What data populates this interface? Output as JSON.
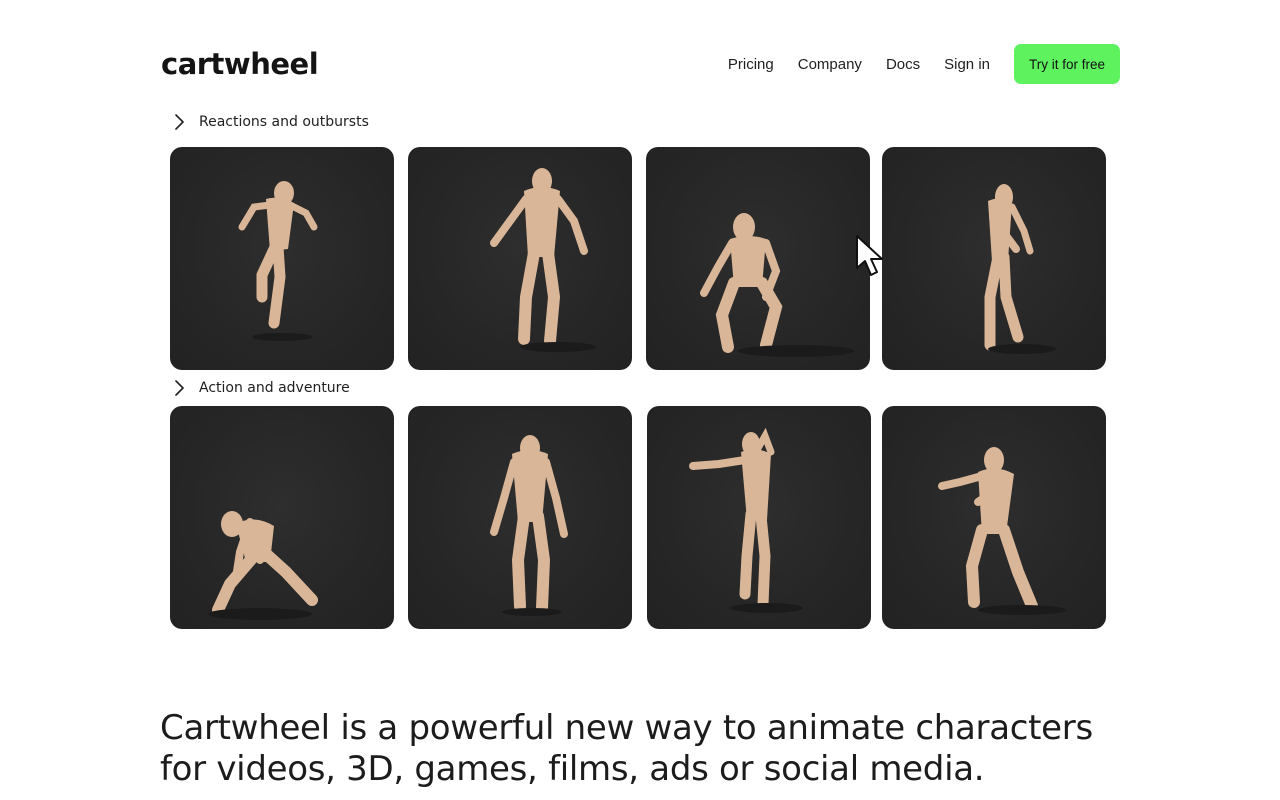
{
  "nav": {
    "logo": "cartwheel",
    "links": [
      "Pricing",
      "Company",
      "Docs",
      "Sign in"
    ],
    "cta": "Try it for free",
    "cta_color": "#5ff25f"
  },
  "sections": [
    {
      "title": "Reactions and outbursts",
      "cards": [
        {
          "pose": "running-leap"
        },
        {
          "pose": "standing-arms-out"
        },
        {
          "pose": "crouching"
        },
        {
          "pose": "side-view-standing"
        }
      ]
    },
    {
      "title": "Action and adventure",
      "cards": [
        {
          "pose": "lunging-low"
        },
        {
          "pose": "idle-standing"
        },
        {
          "pose": "throwing-punch"
        },
        {
          "pose": "fighting-stance"
        }
      ]
    }
  ],
  "headline": "Cartwheel is a powerful new way to animate characters for videos, 3D, games, films, ads or social media.",
  "colors": {
    "card_bg": "#262626",
    "figure": "#d9b697",
    "text": "#1f1f1f"
  }
}
